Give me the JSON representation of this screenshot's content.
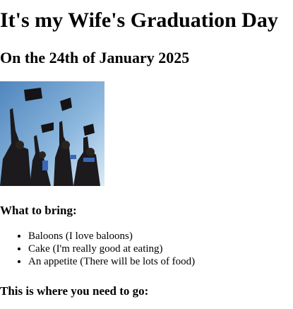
{
  "heading": "It's my Wife's Graduation Day",
  "date_heading": "On the 24th of January 2025",
  "bring_heading": "What to bring:",
  "bring_items": [
    "Baloons (I love baloons)",
    "Cake (I'm really good at eating)",
    "An appetite (There will be lots of food)"
  ],
  "go_heading": "This is where you need to go:",
  "colors": {
    "sky_top": "#5a8fc4",
    "sky_bottom": "#cfe2f1",
    "gown": "#1c1a1c"
  }
}
